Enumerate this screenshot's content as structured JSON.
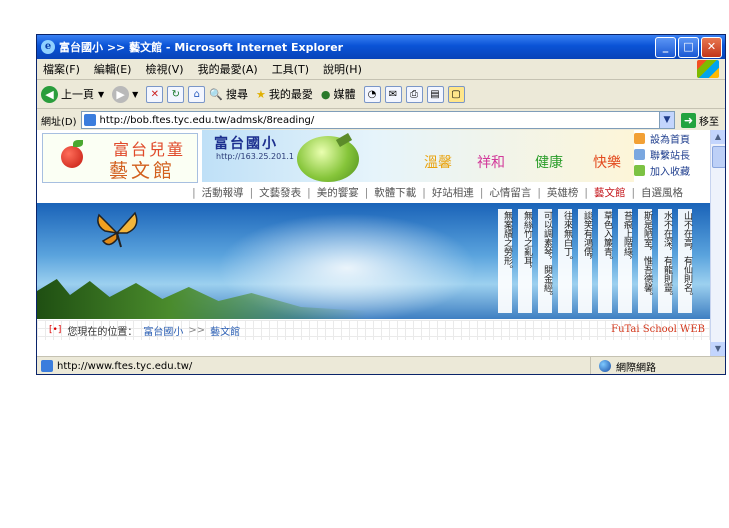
{
  "window": {
    "title": "富台國小 >> 藝文館 - Microsoft Internet Explorer",
    "buttons": [
      "_",
      "□",
      "✕"
    ]
  },
  "menu": [
    "檔案(F)",
    "編輯(E)",
    "檢視(V)",
    "我的最愛(A)",
    "工具(T)",
    "說明(H)"
  ],
  "toolbar": {
    "back": "上一頁",
    "search": "搜尋",
    "favorites": "我的最愛",
    "media": "媒體"
  },
  "address": {
    "label": "網址(D)",
    "url": "http://bob.ftes.tyc.edu.tw/admsk/8reading/",
    "go": "移至"
  },
  "site": {
    "logo_line1": "富台兒童",
    "logo_line2": "藝文館",
    "banner_title": "富台國小",
    "banner_ip": "http://163.25.201.1",
    "banner_words": [
      "溫馨",
      "祥和",
      "健康",
      "快樂"
    ],
    "side_links": [
      "設為首頁",
      "聯繫站長",
      "加入收藏"
    ],
    "nav": [
      "活動報導",
      "文藝發表",
      "美的饗宴",
      "軟體下載",
      "好站相連",
      "心情留言",
      "英雄榜",
      "藝文館",
      "自選風格"
    ],
    "nav_active": "藝文館",
    "poem": [
      "山不在高，有仙則名。",
      "水不在深，有龍則靈。",
      "斯是陋室，惟吾德馨。",
      "苔痕上階綠，",
      "草色入簾青。",
      "談笑有鴻儒，",
      "往來無白丁。",
      "可以調素琴，閱金經。",
      "無絲竹之亂耳，",
      "無案牘之勞形。"
    ],
    "location_label": "您現在的位置：",
    "crumbs": [
      "富台國小",
      "藝文館"
    ],
    "crumb_sep": ">>",
    "brand": "FuTai School WEB"
  },
  "status": {
    "url": "http://www.ftes.tyc.edu.tw/",
    "zone": "網際網路"
  }
}
